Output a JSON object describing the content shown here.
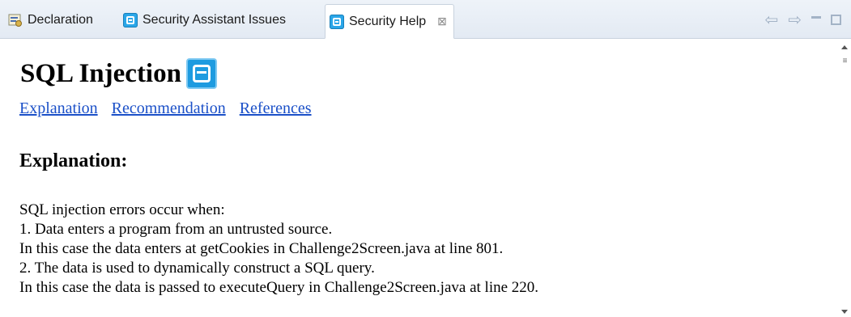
{
  "tabs": [
    {
      "label": "Declaration",
      "icon": "declaration-icon",
      "active": false
    },
    {
      "label": "Security Assistant Issues",
      "icon": "security-assistant-icon",
      "active": false
    },
    {
      "label": "Security Help",
      "icon": "security-help-icon",
      "active": true,
      "close": "⊠"
    }
  ],
  "toolbar": {
    "back": "⇦",
    "forward": "⇨"
  },
  "content": {
    "title": "SQL Injection",
    "links": [
      "Explanation",
      "Recommendation",
      "References"
    ],
    "section_heading": "Explanation:",
    "lines": [
      "SQL injection errors occur when:",
      "1. Data enters a program from an untrusted source.",
      "In this case the data enters at getCookies in Challenge2Screen.java at line 801.",
      "2. The data is used to dynamically construct a SQL query.",
      "In this case the data is passed to executeQuery in Challenge2Screen.java at line 220."
    ]
  },
  "colors": {
    "accent": "#1e9be0",
    "link": "#1b50c8",
    "tabbar": "#e3eaf3"
  }
}
